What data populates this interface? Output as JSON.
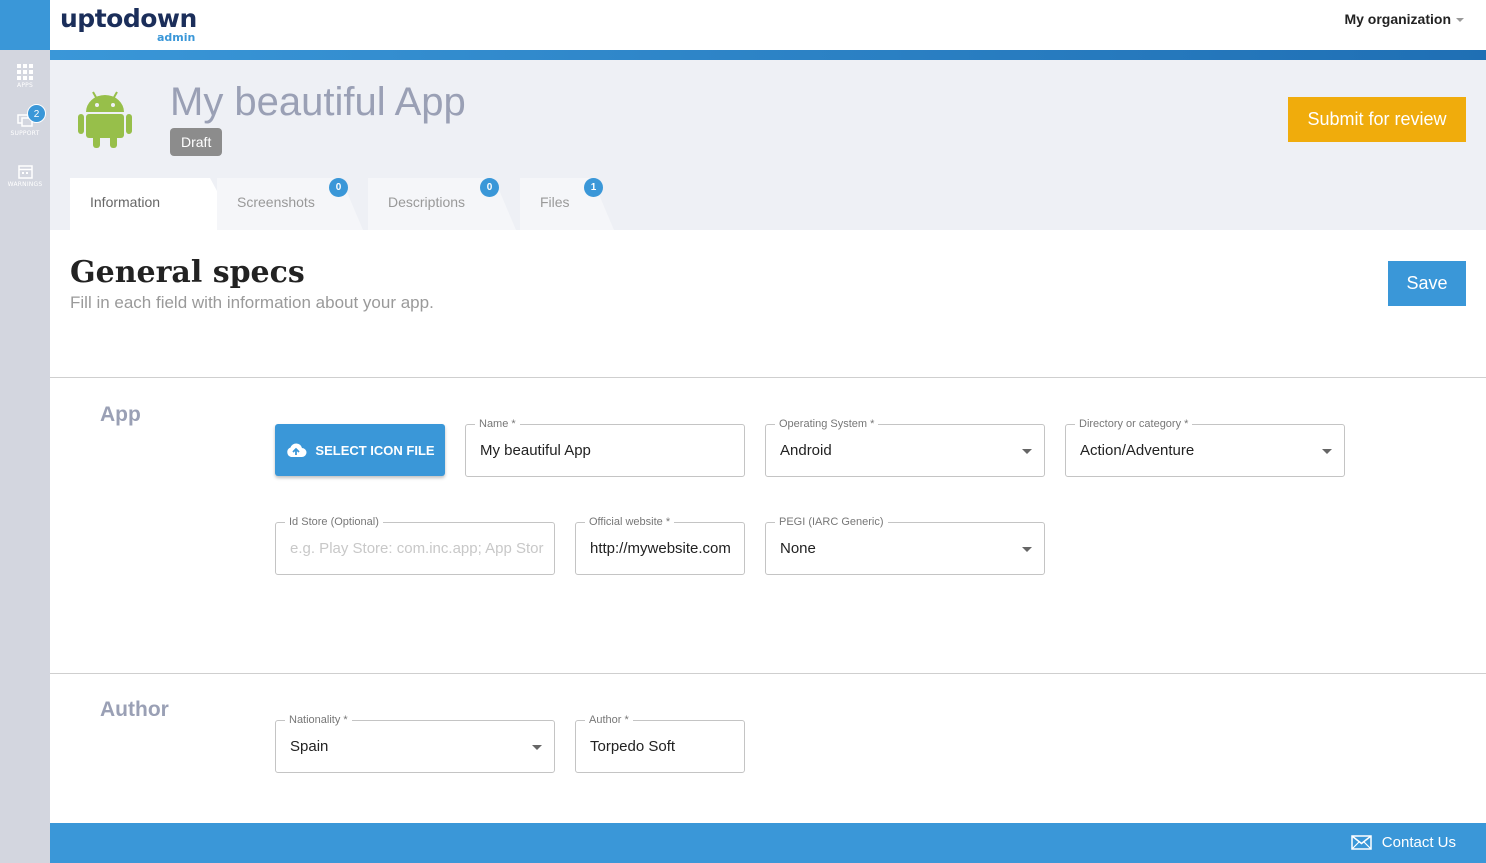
{
  "brand": {
    "logo_main": "uptodown",
    "logo_sub": "admin"
  },
  "header": {
    "organization": "My organization"
  },
  "sidebar": {
    "items": [
      {
        "label": "APPS",
        "icon": "grid-icon"
      },
      {
        "label": "SUPPORT",
        "icon": "chat-icon",
        "badge": "2"
      },
      {
        "label": "WARNINGS",
        "icon": "calendar-icon"
      }
    ]
  },
  "app": {
    "title": "My beautiful App",
    "status": "Draft",
    "submit_label": "Submit for review",
    "icon": "android-icon"
  },
  "tabs": [
    {
      "label": "Information",
      "badge": ""
    },
    {
      "label": "Screenshots",
      "badge": "0"
    },
    {
      "label": "Descriptions",
      "badge": "0"
    },
    {
      "label": "Files",
      "badge": "1"
    }
  ],
  "main": {
    "title": "General specs",
    "subtitle": "Fill in each field with information about your app.",
    "save_label": "Save"
  },
  "app_section": {
    "title": "App",
    "select_icon_label": "SELECT ICON FILE",
    "fields": {
      "name": {
        "label": "Name *",
        "value": "My beautiful App"
      },
      "os": {
        "label": "Operating System *",
        "value": "Android"
      },
      "category": {
        "label": "Directory or category *",
        "value": "Action/Adventure"
      },
      "id_store": {
        "label": "Id Store (Optional)",
        "placeholder": "e.g. Play Store: com.inc.app; App Store:"
      },
      "website": {
        "label": "Official website *",
        "value": "http://mywebsite.com"
      },
      "pegi": {
        "label": "PEGI (IARC Generic)",
        "value": "None"
      }
    }
  },
  "author_section": {
    "title": "Author",
    "fields": {
      "nationality": {
        "label": "Nationality *",
        "value": "Spain"
      },
      "author": {
        "label": "Author *",
        "value": "Torpedo Soft"
      }
    }
  },
  "footer": {
    "contact_label": "Contact Us"
  },
  "colors": {
    "primary": "#3a97d8",
    "accent": "#f0ac0c",
    "sidebar": "#d3d6df",
    "header_bg": "#eef0f5",
    "android": "#97bf4a"
  }
}
